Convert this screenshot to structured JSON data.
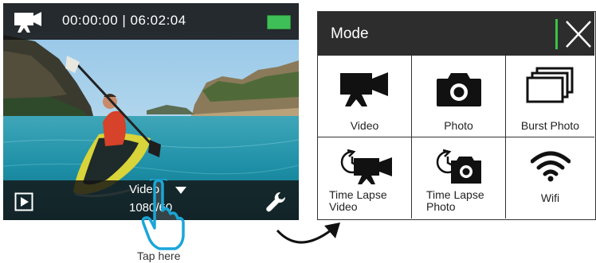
{
  "camera_screen": {
    "timecode": "00:00:00 | 06:02:04",
    "mode_label": "Video",
    "resolution_label": "1080/60",
    "battery_color": "#3fbf57"
  },
  "hint": {
    "tap_label": "Tap here"
  },
  "mode_menu": {
    "title": "Mode",
    "accent_color": "#3cc24a",
    "items": [
      {
        "label": "Video",
        "icon": "video-camera-icon"
      },
      {
        "label": "Photo",
        "icon": "photo-camera-icon"
      },
      {
        "label": "Burst Photo",
        "icon": "burst-photo-icon"
      },
      {
        "label": "Time Lapse Video",
        "icon": "time-lapse-video-icon"
      },
      {
        "label": "Time Lapse Photo",
        "icon": "time-lapse-photo-icon"
      },
      {
        "label": "Wifi",
        "icon": "wifi-icon"
      }
    ]
  }
}
